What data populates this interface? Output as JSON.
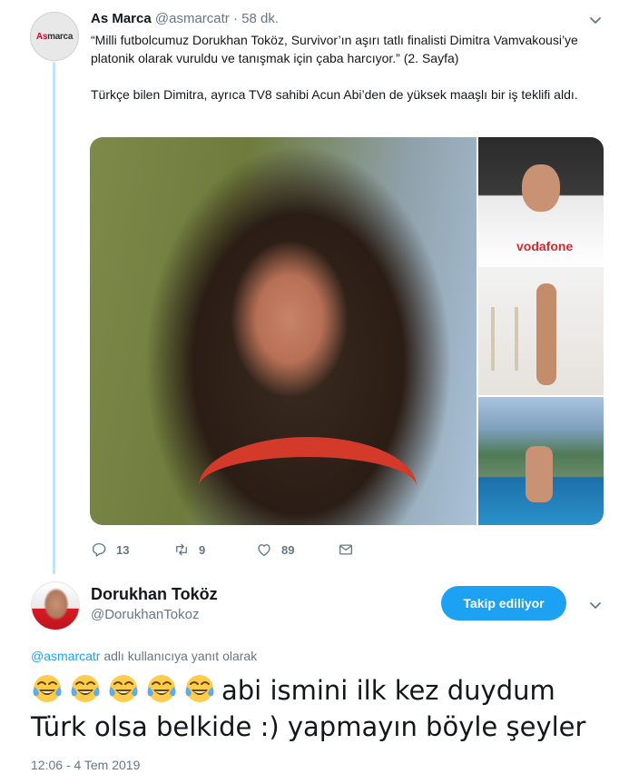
{
  "parent_tweet": {
    "avatar_logo": {
      "as": "As",
      "marca": "marca"
    },
    "name": "As Marca",
    "handle": "@asmarcatr",
    "dot": "·",
    "time": "58 dk.",
    "text_1": "“Milli futbolcumuz Dorukhan Toköz, Survivor’ın aşırı tatlı finalisti Dimitra Vamvakousi’ye platonik olarak vuruldu ve tanışmak için çaba harcıyor.” (2. Sayfa)",
    "text_2": "Türkçe bilen Dimitra, ayrıca TV8 sahibi Acun Abi’den de yüksek maaşlı bir iş teklifi aldı.",
    "media_sponsor": "vodafone",
    "actions": {
      "reply_count": "13",
      "retweet_count": "9",
      "like_count": "89"
    }
  },
  "reply_tweet": {
    "name": "Dorukhan Toköz",
    "handle": "@DorukhanTokoz",
    "follow_label": "Takip ediliyor",
    "reply_to_user": "@asmarcatr",
    "reply_to_suffix": " adlı kullanıcıya yanıt olarak",
    "text_line_1": "abi ismini ilk kez duydum",
    "text_line_2": "Türk olsa belkide :) yapmayın böyle şeyler",
    "emoji_count": 5,
    "date": "12:06 - 4 Tem 2019"
  },
  "colors": {
    "accent": "#1da1f2",
    "thread_line": "#c4e3f3",
    "secondary_text": "#657786",
    "primary_text": "#14171a"
  },
  "icons": {
    "caret": "chevron-down-icon",
    "reply": "reply-icon",
    "retweet": "retweet-icon",
    "like": "heart-icon",
    "dm": "envelope-icon",
    "emoji": "tears-of-joy-emoji-icon"
  }
}
